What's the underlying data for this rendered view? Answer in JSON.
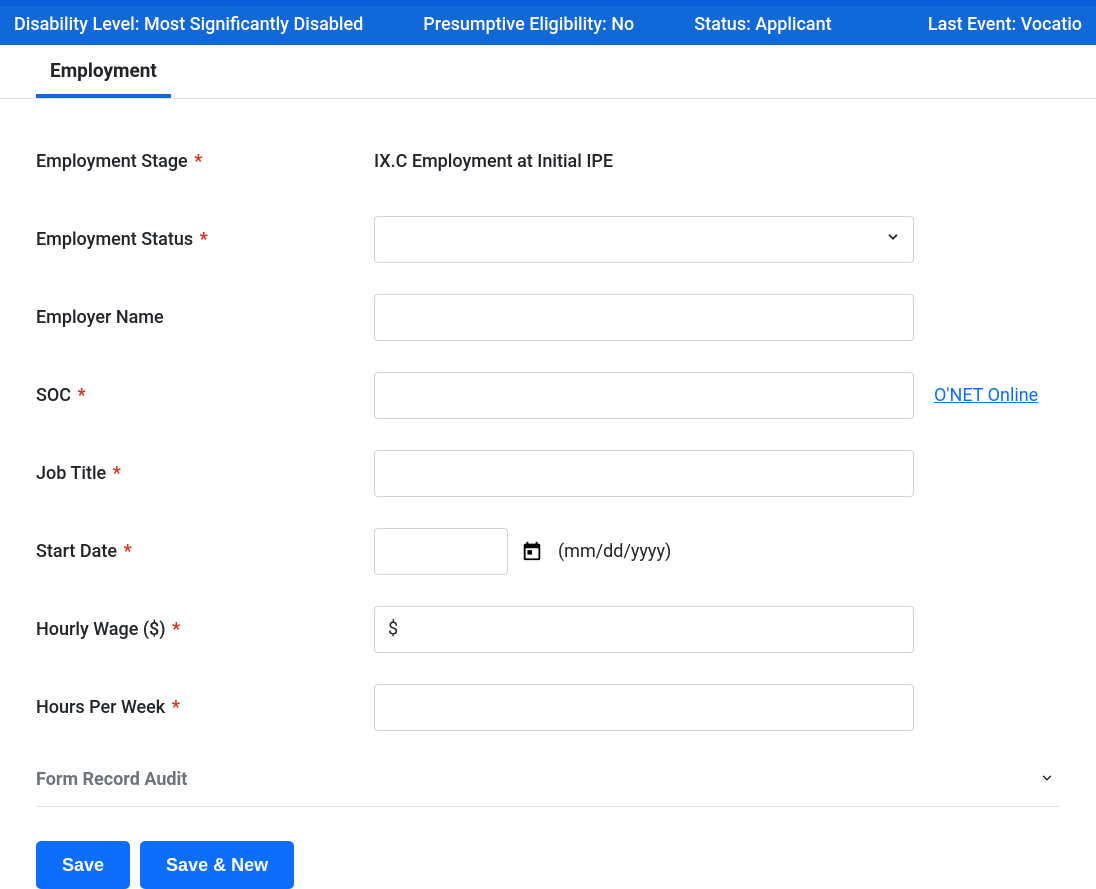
{
  "statusbar": {
    "disability_level": "Disability Level: Most Significantly Disabled",
    "presumptive": "Presumptive Eligibility: No",
    "status": "Status: Applicant",
    "last_event": "Last Event: Vocatio"
  },
  "tabs": {
    "employment": "Employment"
  },
  "labels": {
    "employment_stage": "Employment Stage",
    "employment_status": "Employment Status",
    "employer_name": "Employer Name",
    "soc": "SOC",
    "job_title": "Job Title",
    "start_date": "Start Date",
    "hourly_wage": "Hourly Wage ($)",
    "hours_per_week": "Hours Per Week"
  },
  "required_marker": "*",
  "values": {
    "employment_stage": "IX.C Employment at Initial IPE",
    "employment_status": "",
    "employer_name": "",
    "soc": "",
    "job_title": "",
    "start_date": "",
    "hourly_wage": "",
    "hours_per_week": ""
  },
  "date_hint": "(mm/dd/yyyy)",
  "wage_prefix": "$",
  "links": {
    "onet": "O'NET Online"
  },
  "audit": {
    "title": "Form Record Audit"
  },
  "buttons": {
    "save": "Save",
    "save_new": "Save & New"
  }
}
